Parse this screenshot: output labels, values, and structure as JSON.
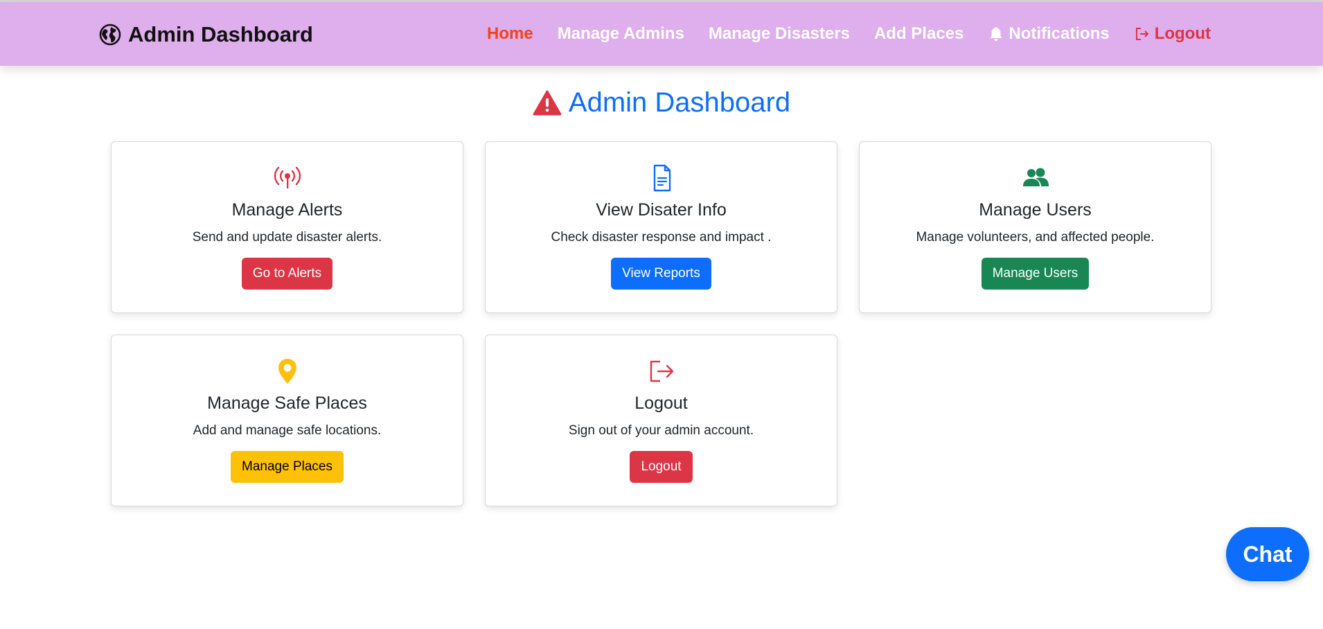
{
  "navbar": {
    "brand": "Admin Dashboard",
    "brand_icon": "globe-icon",
    "links": [
      {
        "label": "Home",
        "active": true
      },
      {
        "label": "Manage Admins"
      },
      {
        "label": "Manage Disasters"
      },
      {
        "label": "Add Places"
      },
      {
        "label": "Notifications",
        "icon": "bell-icon"
      },
      {
        "label": "Logout",
        "icon": "logout-icon"
      }
    ]
  },
  "page": {
    "title": "Admin Dashboard",
    "title_icon": "warning-triangle-icon"
  },
  "cards": [
    {
      "icon": "broadcast-icon",
      "icon_color": "#dc3545",
      "title": "Manage Alerts",
      "text": "Send and update disaster alerts.",
      "button": "Go to Alerts",
      "button_color": "#dc3545"
    },
    {
      "icon": "document-icon",
      "icon_color": "#0d6efd",
      "title": "View Disater Info",
      "text": "Check disaster response and impact .",
      "button": "View Reports",
      "button_color": "#0d6efd"
    },
    {
      "icon": "users-icon",
      "icon_color": "#198754",
      "title": "Manage Users",
      "text": "Manage volunteers, and affected people.",
      "button": "Manage Users",
      "button_color": "#198754"
    },
    {
      "icon": "map-pin-icon",
      "icon_color": "#ffc107",
      "title": "Manage Safe Places",
      "text": "Add and manage safe locations.",
      "button": "Manage Places",
      "button_color": "#ffc107"
    },
    {
      "icon": "logout-icon",
      "icon_color": "#dc3545",
      "title": "Logout",
      "text": "Sign out of your admin account.",
      "button": "Logout",
      "button_color": "#dc3545"
    }
  ],
  "chat": {
    "label": "Chat"
  }
}
